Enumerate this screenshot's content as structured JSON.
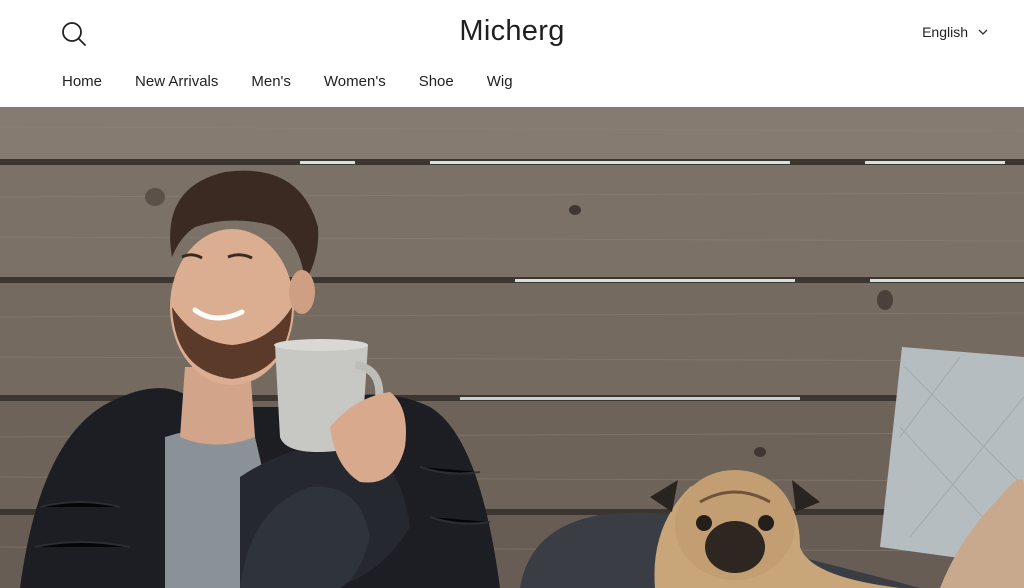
{
  "brand": {
    "name": "Micherg"
  },
  "icons": {
    "search": "search-icon",
    "chevron": "chevron-down-icon"
  },
  "language": {
    "selected": "English"
  },
  "nav": {
    "items": [
      {
        "label": "Home"
      },
      {
        "label": "New Arrivals"
      },
      {
        "label": "Men's"
      },
      {
        "label": "Women's"
      },
      {
        "label": "Shoe"
      },
      {
        "label": "Wig"
      }
    ]
  },
  "hero": {
    "description_visible": false
  },
  "colors": {
    "text": "#222222",
    "background": "#ffffff",
    "wood": "#7a7066",
    "jacket": "#1d1f24",
    "shirt": "#8e969b",
    "mug": "#c9c9c6",
    "pug": "#c9a57a",
    "pillow": "#b9c0c3"
  }
}
